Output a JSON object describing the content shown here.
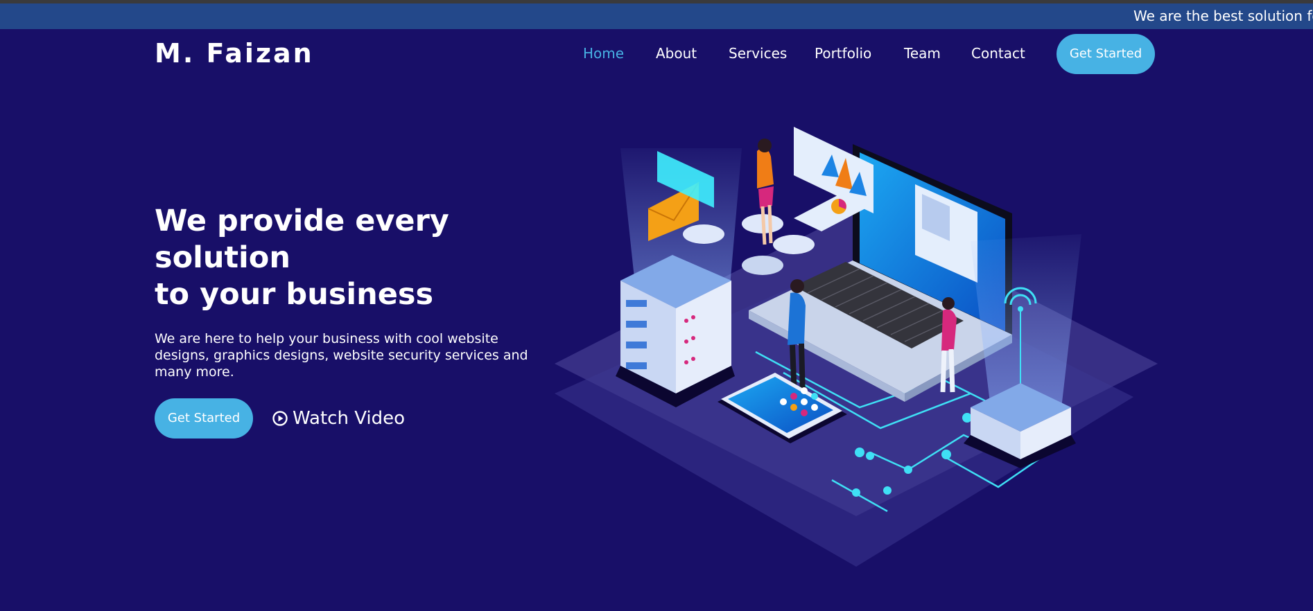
{
  "announcement": {
    "text": "We are the best solution fo"
  },
  "header": {
    "logo": "M. Faizan",
    "nav": [
      {
        "label": "Home",
        "active": true
      },
      {
        "label": "About",
        "active": false
      },
      {
        "label": "Services",
        "active": false
      },
      {
        "label": "Portfolio",
        "active": false
      },
      {
        "label": "Team",
        "active": false
      },
      {
        "label": "Contact",
        "active": false
      }
    ],
    "cta_label": "Get Started"
  },
  "hero": {
    "title_line1": "We provide every solution",
    "title_line2": "to your business",
    "subtitle": "We are here to help your business with cool website designs, graphics designs, website security services and many more.",
    "cta_label": "Get Started",
    "video_label": "Watch Video",
    "video_icon": "play-circle-icon",
    "illustration": "isometric-tech-illustration"
  },
  "colors": {
    "background": "#180f68",
    "announcement_bar": "#23488a",
    "accent": "#47b2e4",
    "text": "#ffffff"
  }
}
